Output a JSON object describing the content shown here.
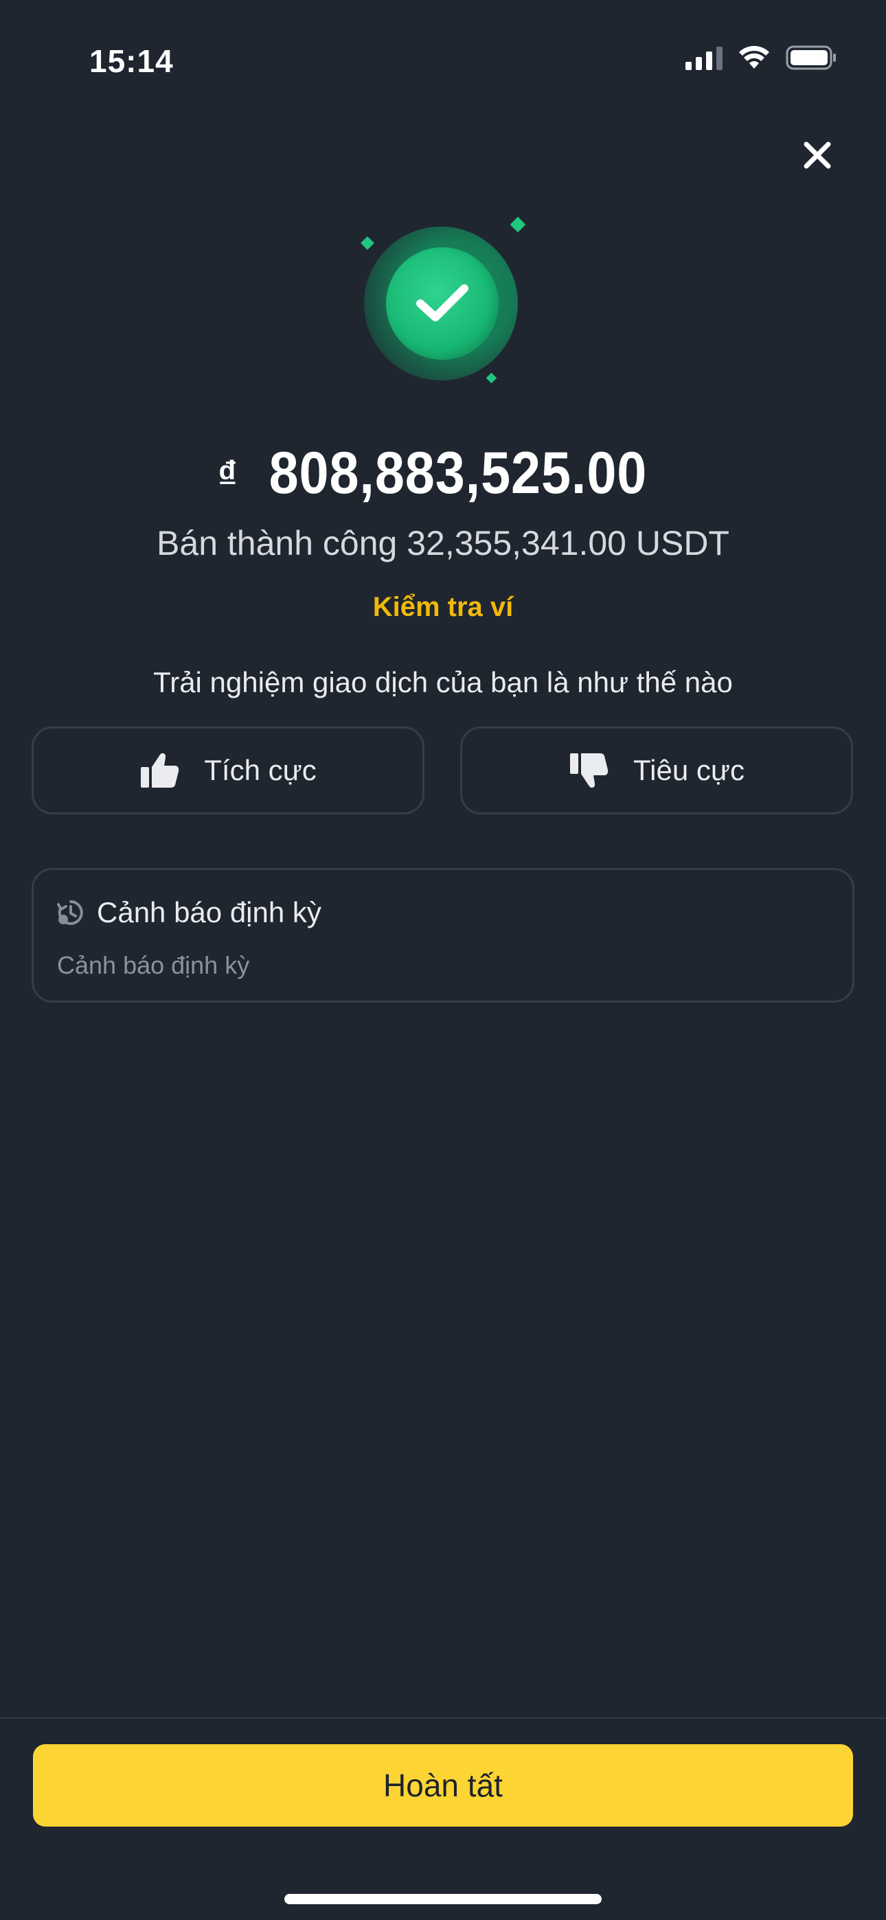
{
  "status_bar": {
    "time": "15:14",
    "icons": [
      "signal-icon",
      "wifi-icon",
      "battery-icon"
    ]
  },
  "header": {
    "close_icon": "close-icon"
  },
  "success": {
    "icon": "check-icon",
    "currency_symbol": "₫",
    "amount": "808,883,525.00",
    "message": "Bán thành công 32,355,341.00 USDT",
    "check_wallet_label": "Kiểm tra ví"
  },
  "feedback": {
    "question": "Trải nghiệm giao dịch của bạn là như thế nào",
    "positive_label": "Tích cực",
    "negative_label": "Tiêu cực"
  },
  "recurring_alert": {
    "title": "Cảnh báo định kỳ",
    "subtitle": "Cảnh báo định kỳ"
  },
  "footer": {
    "done_label": "Hoàn tất"
  },
  "colors": {
    "background": "#1f2630",
    "accent_yellow": "#f0b90b",
    "button_yellow": "#fcd535",
    "success_green": "#18b874",
    "border": "#363d48"
  }
}
